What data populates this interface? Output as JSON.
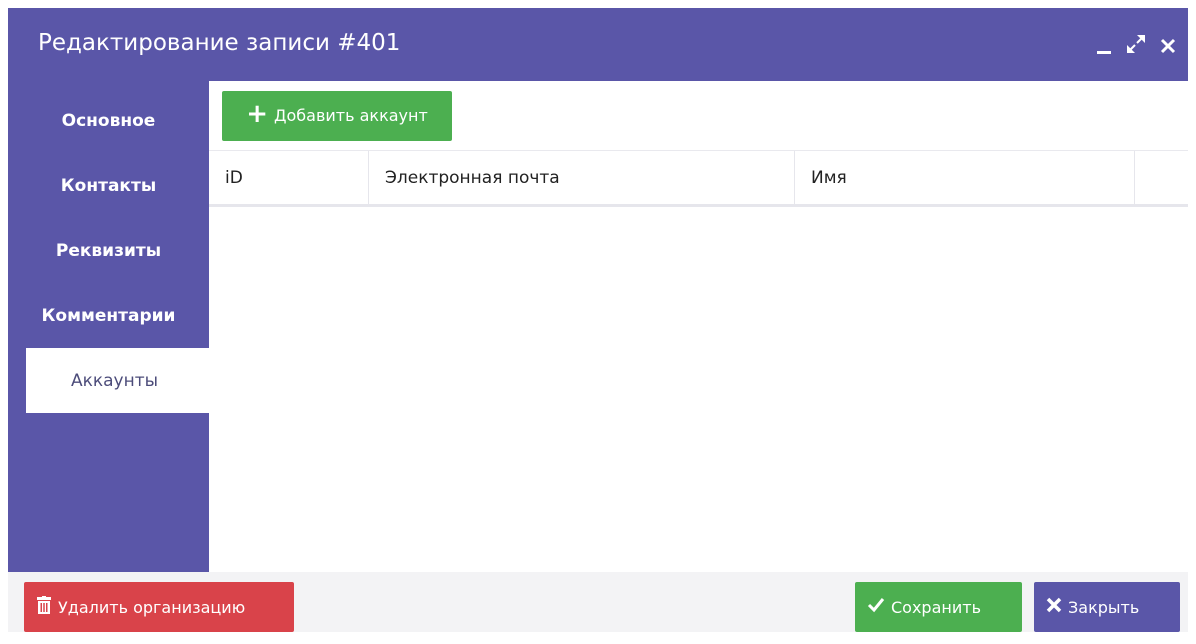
{
  "window": {
    "title": "Редактирование записи #401",
    "controls": [
      "minimize-icon",
      "maximize-icon",
      "close-icon"
    ]
  },
  "sidebar": {
    "items": [
      {
        "label": "Основное",
        "active": false
      },
      {
        "label": "Контакты",
        "active": false
      },
      {
        "label": "Реквизиты",
        "active": false
      },
      {
        "label": "Комментарии",
        "active": false
      },
      {
        "label": "Аккаунты",
        "active": true
      }
    ]
  },
  "toolbar": {
    "add_label": "Добавить аккаунт",
    "add_icon": "plus-icon"
  },
  "table": {
    "columns": [
      "iD",
      "Электронная почта",
      "Имя",
      ""
    ],
    "rows": []
  },
  "footer": {
    "delete_label": "Удалить организацию",
    "delete_icon": "trash-icon",
    "save_label": "Сохранить",
    "save_icon": "check-icon",
    "close_label": "Закрыть",
    "close_icon": "close-icon"
  },
  "colors": {
    "accent": "#5a56a8",
    "success": "#4caf50",
    "danger": "#d9434a"
  }
}
